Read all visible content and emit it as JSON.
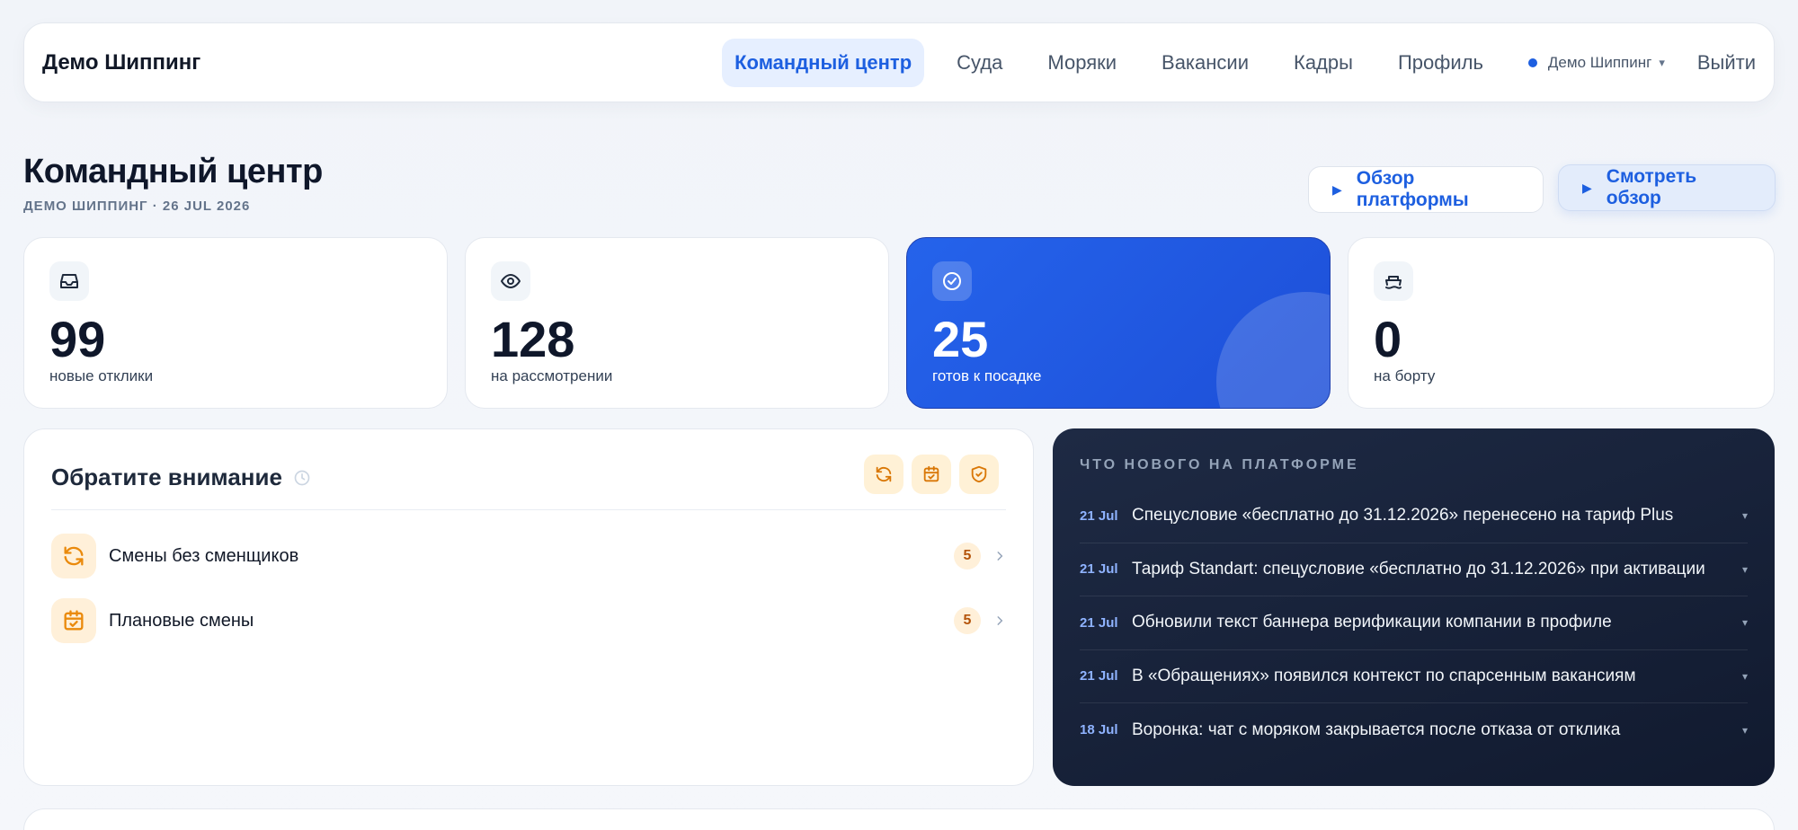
{
  "nav": {
    "brand": "Демо Шиппинг",
    "links": [
      "Командный центр",
      "Суда",
      "Моряки",
      "Вакансии",
      "Кадры",
      "Профиль"
    ],
    "active_index": 0,
    "account": "Демо Шиппинг",
    "account_caret": "▾",
    "logout": "Выйти"
  },
  "header": {
    "title": "Командный центр",
    "subtitle": "ДЕМО ШИППИНГ · 26 JUL 2026",
    "btn_overview": "Обзор платформы",
    "btn_watch": "Смотреть обзор"
  },
  "stats": [
    {
      "value": "99",
      "label": "новые отклики",
      "icon": "inbox-icon"
    },
    {
      "value": "128",
      "label": "на рассмотрении",
      "icon": "eye-icon"
    },
    {
      "value": "25",
      "label": "готов к посадке",
      "icon": "check-circle-icon"
    },
    {
      "value": "0",
      "label": "на борту",
      "icon": "ship-icon"
    }
  ],
  "attention": {
    "title": "Обратите внимание",
    "items": [
      {
        "label": "Смены без сменщиков",
        "count": "5",
        "icon": "refresh-icon"
      },
      {
        "label": "Плановые смены",
        "count": "5",
        "icon": "calendar-check-icon"
      }
    ]
  },
  "news": {
    "title": "ЧТО НОВОГО НА ПЛАТФОРМЕ",
    "items": [
      {
        "date": "21 Jul",
        "text": "Спецусловие «бесплатно до 31.12.2026» перенесено на тариф Plus"
      },
      {
        "date": "21 Jul",
        "text": "Тариф Standart: спецусловие «бесплатно до 31.12.2026» при активации"
      },
      {
        "date": "21 Jul",
        "text": "Обновили текст баннера верификации компании в профиле"
      },
      {
        "date": "21 Jul",
        "text": "В «Обращениях» появился контекст по спарсенным вакансиям"
      },
      {
        "date": "18 Jul",
        "text": "Воронка: чат с моряком закрывается после отказа от отклика"
      }
    ],
    "caret": "▾"
  },
  "colors": {
    "accent": "#1d5fe0",
    "primary_card": "#2563eb",
    "news_bg": "#16203a",
    "warning_soft": "#fff1d6"
  }
}
